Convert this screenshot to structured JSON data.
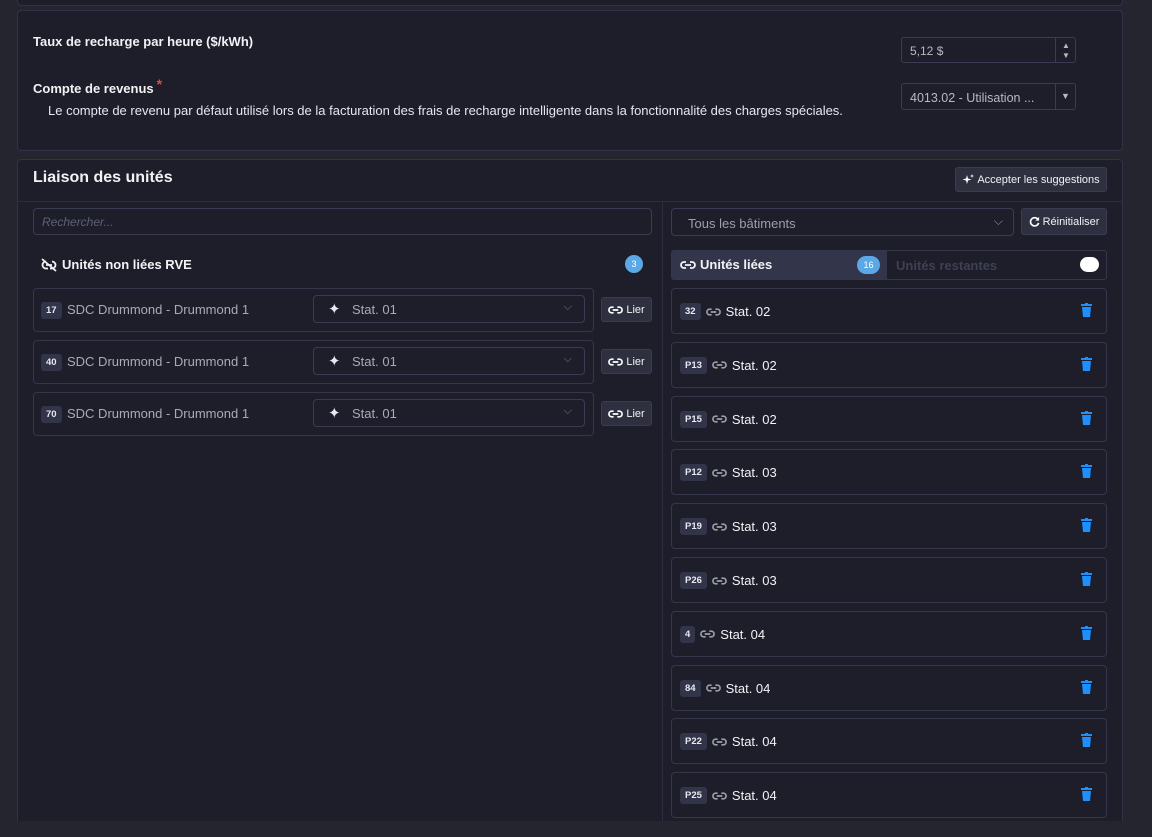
{
  "settings": {
    "rate_label": "Taux de recharge par heure ($/kWh)",
    "rate_value": "5,12 $",
    "revenue_label": "Compte de revenus",
    "required_mark": "*",
    "revenue_desc": "Le compte de revenu par défaut utilisé lors de la facturation des frais de recharge intelligente dans la fonctionnalité des charges spéciales.",
    "revenue_value": "4013.02 - Utilisation ..."
  },
  "linking": {
    "title": "Liaison des unités",
    "accept_label": "Accepter les suggestions",
    "search_placeholder": "Rechercher...",
    "building_value": "Tous les bâtiments",
    "reset_label": "Réinitialiser",
    "unlinked_title": "Unités non liées RVE",
    "unlinked_count": "3",
    "link_label": "Lier",
    "unlinked": [
      {
        "badge": "17",
        "name": "SDC Drummond - Drummond 1",
        "station": "Stat. 01"
      },
      {
        "badge": "40",
        "name": "SDC Drummond - Drummond 1",
        "station": "Stat. 01"
      },
      {
        "badge": "70",
        "name": "SDC Drummond - Drummond 1",
        "station": "Stat. 01"
      }
    ],
    "linked_tab": "Unités liées",
    "linked_count": "16",
    "remaining_tab": "Unités restantes",
    "linked": [
      {
        "badge": "32",
        "station": "Stat. 02"
      },
      {
        "badge": "P13",
        "station": "Stat. 02"
      },
      {
        "badge": "P15",
        "station": "Stat. 02"
      },
      {
        "badge": "P12",
        "station": "Stat. 03"
      },
      {
        "badge": "P19",
        "station": "Stat. 03"
      },
      {
        "badge": "P26",
        "station": "Stat. 03"
      },
      {
        "badge": "4",
        "station": "Stat. 04"
      },
      {
        "badge": "84",
        "station": "Stat. 04"
      },
      {
        "badge": "P22",
        "station": "Stat. 04"
      },
      {
        "badge": "P25",
        "station": "Stat. 04"
      }
    ]
  },
  "colors": {
    "accent": "#1e8fff",
    "badge_count": "#5aa9e6",
    "required": "#e04a4a"
  }
}
